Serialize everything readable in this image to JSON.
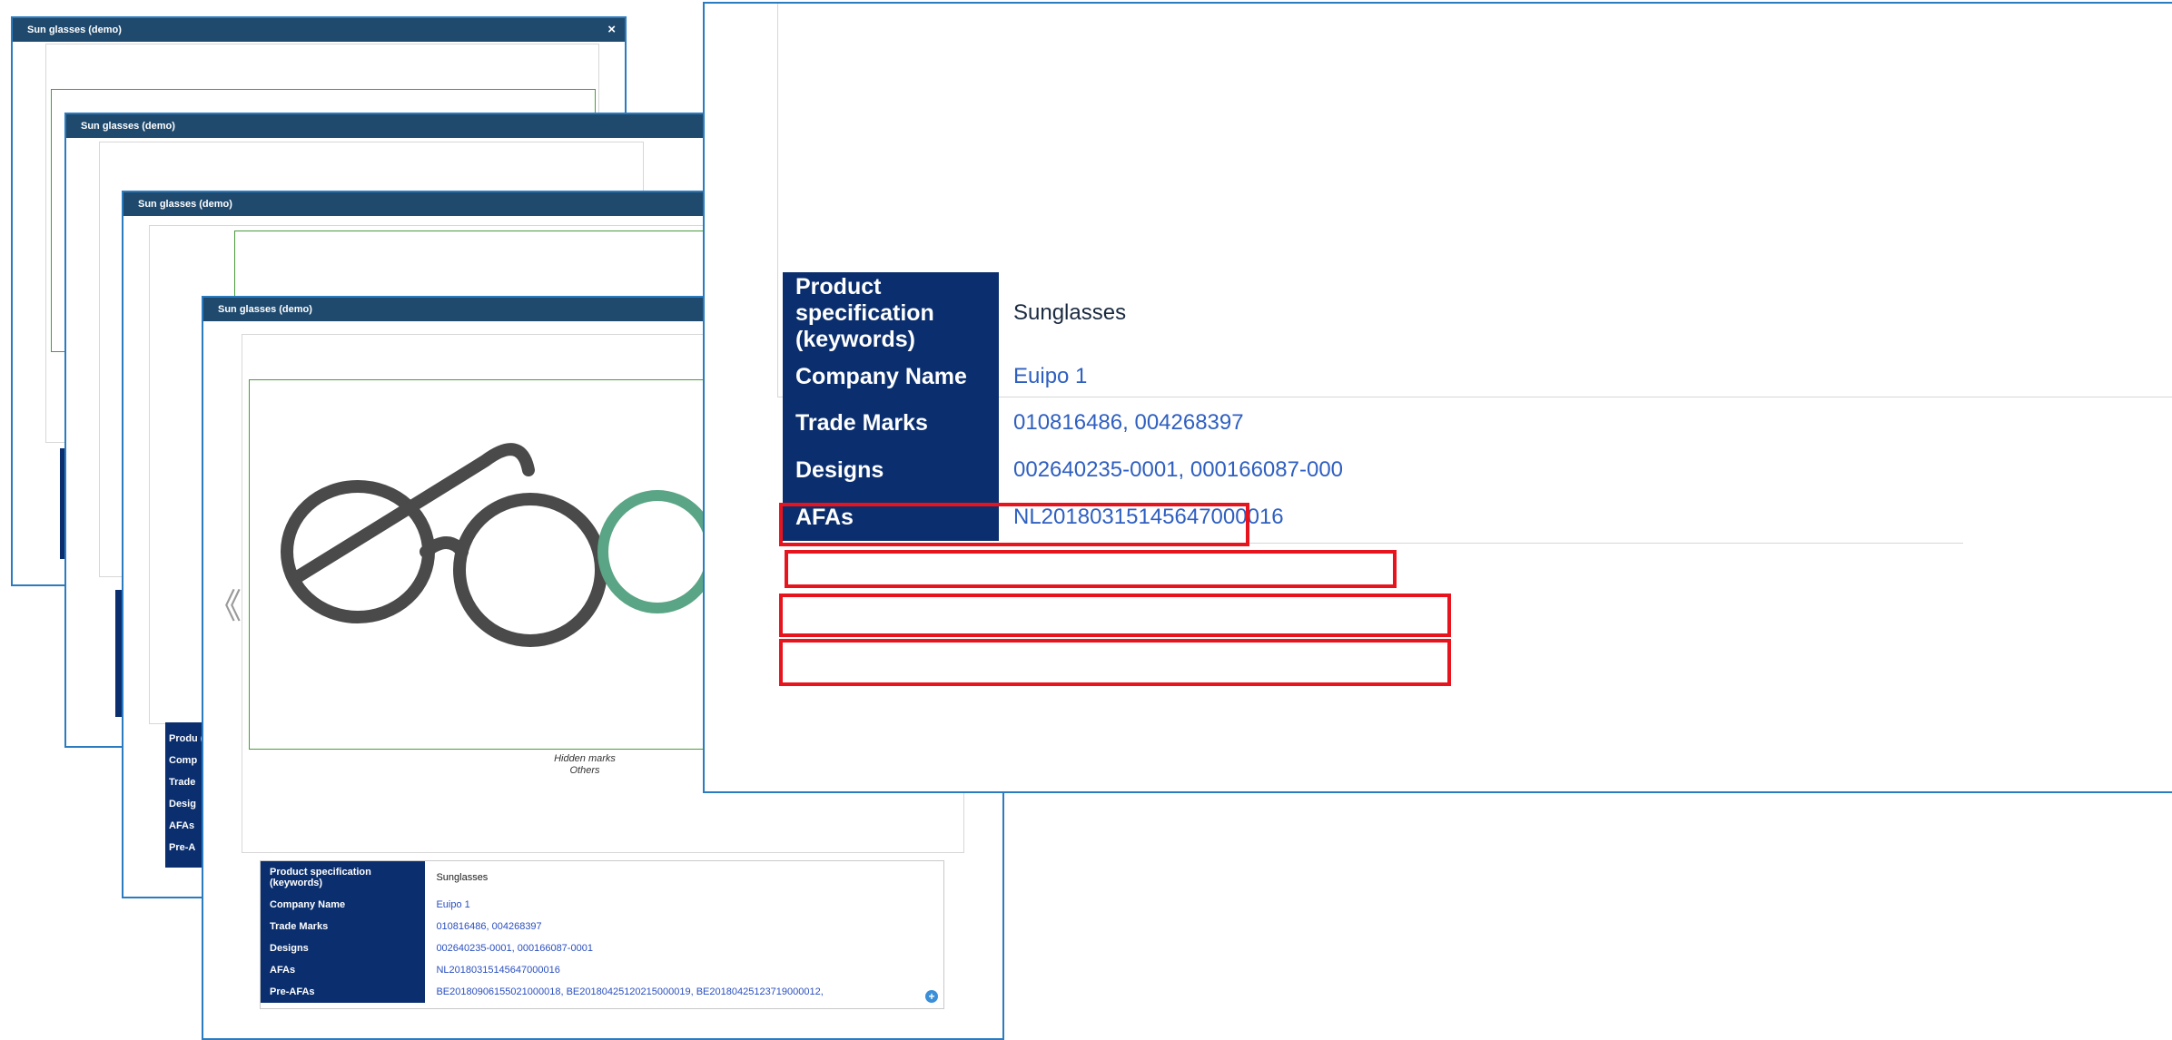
{
  "window_title": "Sun glasses (demo)",
  "close_glyph": "×",
  "prev_glyph": "《",
  "caption": {
    "line1": "Hidden marks",
    "line2": "Others"
  },
  "spec_small": {
    "rows": [
      {
        "label": "Product specification (keywords)",
        "value": "Sunglasses"
      },
      {
        "label": "Company Name",
        "value": "Euipo 1"
      },
      {
        "label": "Trade Marks",
        "value": "010816486, 004268397"
      },
      {
        "label": "Designs",
        "value": "002640235-0001, 000166087-0001"
      },
      {
        "label": "AFAs",
        "value": "NL20180315145647000016"
      },
      {
        "label": "Pre-AFAs",
        "value": "BE20180906155021000018, BE20180425120215000019, BE20180425123719000012,"
      }
    ]
  },
  "peek_labels": [
    "Produ (keyw",
    "Comp",
    "Trade",
    "Desig",
    "AFAs",
    "Pre-A"
  ],
  "spec_zoom": {
    "rows": [
      {
        "label": "Product specification (keywords)",
        "value": "Sunglasses"
      },
      {
        "label": "Company Name",
        "value": "Euipo 1"
      },
      {
        "label": "Trade Marks",
        "value": "010816486, 004268397"
      },
      {
        "label": "Designs",
        "value": "002640235-0001, 000166087-000"
      },
      {
        "label": "AFAs",
        "value": "NL20180315145647000016"
      }
    ]
  },
  "colors": {
    "titlebar": "#1f4a6e",
    "label_bg": "#0b2f6e",
    "highlight": "#e8141d",
    "frame_green": "#4a9a3d"
  }
}
